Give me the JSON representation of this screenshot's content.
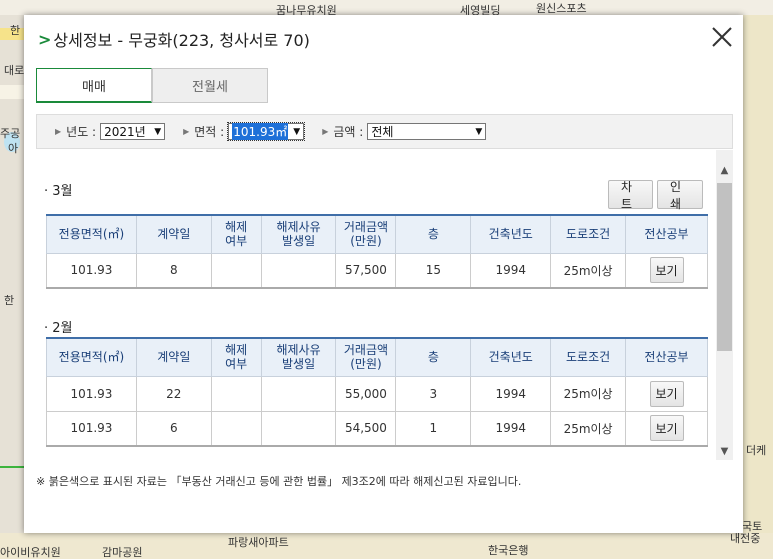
{
  "map": {
    "labels": [
      "꿈나무유치원",
      "세영빌딩",
      "원신스포츠",
      "한",
      "대로",
      "주공",
      "아",
      "한",
      "파랑새아파트",
      "한국은행",
      "아이비유치원",
      "감마공원",
      "국토",
      "내전중",
      "더케"
    ]
  },
  "dialog": {
    "title": "상세정보 - 무궁화(223, 청사서로 70)",
    "close_icon": "close-icon"
  },
  "tabs": [
    {
      "label": "매매",
      "active": true
    },
    {
      "label": "전월세",
      "active": false
    }
  ],
  "filters": {
    "year": {
      "label": "년도 :",
      "value": "2021년"
    },
    "area": {
      "label": "면적 :",
      "value": "101.93㎡"
    },
    "amount": {
      "label": "금액 :",
      "value": "전체"
    }
  },
  "buttons": {
    "chart": "차트",
    "print": "인쇄",
    "view": "보기"
  },
  "columns": [
    [
      "전용면적(㎡)"
    ],
    [
      "계약일"
    ],
    [
      "해제",
      "여부"
    ],
    [
      "해제사유",
      "발생일"
    ],
    [
      "거래금액",
      "(만원)"
    ],
    [
      "층"
    ],
    [
      "건축년도"
    ],
    [
      "도로조건"
    ],
    [
      "전산공부"
    ]
  ],
  "sections": [
    {
      "title": "· 3월",
      "rows": [
        {
          "area": "101.93",
          "day": "8",
          "cancel": "",
          "cancel_date": "",
          "price": "57,500",
          "floor": "15",
          "built": "1994",
          "road": "25m이상"
        }
      ]
    },
    {
      "title": "· 2월",
      "rows": [
        {
          "area": "101.93",
          "day": "22",
          "cancel": "",
          "cancel_date": "",
          "price": "55,000",
          "floor": "3",
          "built": "1994",
          "road": "25m이상"
        },
        {
          "area": "101.93",
          "day": "6",
          "cancel": "",
          "cancel_date": "",
          "price": "54,500",
          "floor": "1",
          "built": "1994",
          "road": "25m이상"
        }
      ]
    }
  ],
  "footnote": "※ 붉은색으로 표시된 자료는 「부동산 거래신고 등에 관한 법률」 제3조2에 따라 해제신고된 자료입니다."
}
